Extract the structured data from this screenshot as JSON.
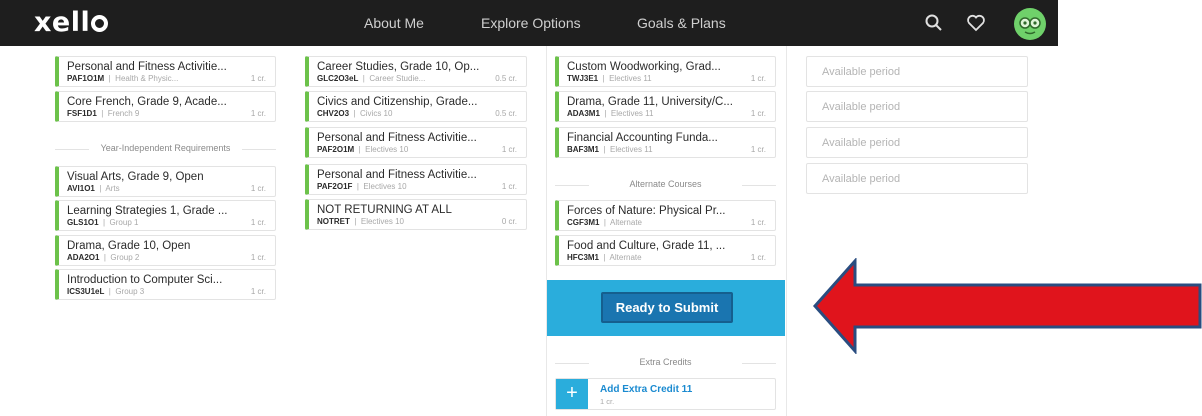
{
  "nav": {
    "logo": "xell",
    "links": [
      "About Me",
      "Explore Options",
      "Goals & Plans"
    ]
  },
  "col1": {
    "cards_top": [
      {
        "title": "Personal and Fitness Activitie...",
        "code": "PAF1O1M",
        "category": "Health & Physic...",
        "credit": "1 cr."
      },
      {
        "title": "Core French, Grade 9, Acade...",
        "code": "FSF1D1",
        "category": "French 9",
        "credit": "1 cr."
      }
    ],
    "section": "Year-Independent Requirements",
    "cards_bottom": [
      {
        "title": "Visual Arts, Grade 9, Open",
        "code": "AVI1O1",
        "category": "Arts",
        "credit": "1 cr."
      },
      {
        "title": "Learning Strategies 1, Grade ...",
        "code": "GLS1O1",
        "category": "Group 1",
        "credit": "1 cr."
      },
      {
        "title": "Drama, Grade 10, Open",
        "code": "ADA2O1",
        "category": "Group 2",
        "credit": "1 cr."
      },
      {
        "title": "Introduction to Computer Sci...",
        "code": "ICS3U1eL",
        "category": "Group 3",
        "credit": "1 cr."
      }
    ]
  },
  "col2": {
    "cards": [
      {
        "title": "Career Studies, Grade 10, Op...",
        "code": "GLC2O3eL",
        "category": "Career Studie...",
        "credit": "0.5 cr."
      },
      {
        "title": "Civics and Citizenship, Grade...",
        "code": "CHV2O3",
        "category": "Civics 10",
        "credit": "0.5 cr."
      },
      {
        "title": "Personal and Fitness Activitie...",
        "code": "PAF2O1M",
        "category": "Electives 10",
        "credit": "1 cr."
      },
      {
        "title": "Personal and Fitness Activitie...",
        "code": "PAF2O1F",
        "category": "Electives 10",
        "credit": "1 cr."
      },
      {
        "title": "NOT RETURNING AT ALL",
        "code": "NOTRET",
        "category": "Electives 10",
        "credit": "0 cr."
      }
    ]
  },
  "col3": {
    "cards": [
      {
        "title": "Custom Woodworking, Grad...",
        "code": "TWJ3E1",
        "category": "Electives 11",
        "credit": "1 cr."
      },
      {
        "title": "Drama, Grade 11, University/C...",
        "code": "ADA3M1",
        "category": "Electives 11",
        "credit": "1 cr."
      },
      {
        "title": "Financial Accounting Funda...",
        "code": "BAF3M1",
        "category": "Electives 11",
        "credit": "1 cr."
      }
    ],
    "alt_section": "Alternate Courses",
    "alt_cards": [
      {
        "title": "Forces of Nature: Physical Pr...",
        "code": "CGF3M1",
        "category": "Alternate",
        "credit": "1 cr."
      },
      {
        "title": "Food and Culture, Grade 11, ...",
        "code": "HFC3M1",
        "category": "Alternate",
        "credit": "1 cr."
      }
    ],
    "submit_label": "Ready to Submit",
    "extra_section": "Extra Credits",
    "extra_title": "Add Extra Credit 11",
    "extra_credit": "1 cr."
  },
  "col4": {
    "periods": [
      "Available period",
      "Available period",
      "Available period",
      "Available period"
    ]
  },
  "colors": {
    "nav_bg": "#1e1e1e",
    "accent_green": "#6cc24a",
    "submit_panel": "#2aaddc",
    "submit_button": "#1a75b0",
    "arrow_red": "#e0141c",
    "arrow_outline": "#2a4d80"
  }
}
